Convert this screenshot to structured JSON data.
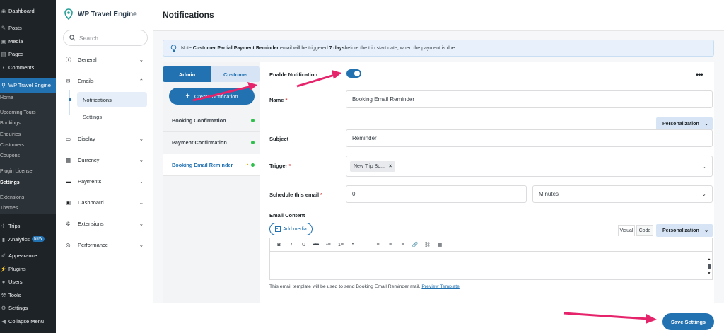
{
  "wp_sidebar": {
    "items": [
      {
        "label": "Dashboard",
        "icon": "dashboard-icon"
      },
      {
        "label": "Posts",
        "icon": "pin-icon"
      },
      {
        "label": "Media",
        "icon": "media-icon"
      },
      {
        "label": "Pages",
        "icon": "pages-icon"
      },
      {
        "label": "Comments",
        "icon": "comment-icon"
      },
      {
        "label": "WP Travel Engine",
        "icon": "travel-icon"
      }
    ],
    "submenu": [
      "Home",
      "Upcoming Tours",
      "Bookings",
      "Enquiries",
      "Customers",
      "Coupons",
      "Plugin License",
      "Settings",
      "Extensions",
      "Themes"
    ],
    "items2": [
      {
        "label": "Trips",
        "icon": "trips-icon"
      },
      {
        "label": "Analytics",
        "icon": "analytics-icon"
      },
      {
        "label": "Appearance",
        "icon": "brush-icon"
      },
      {
        "label": "Plugins",
        "icon": "plug-icon"
      },
      {
        "label": "Users",
        "icon": "user-icon"
      },
      {
        "label": "Tools",
        "icon": "wrench-icon"
      },
      {
        "label": "Settings",
        "icon": "settings-icon"
      },
      {
        "label": "Collapse Menu",
        "icon": "collapse-icon"
      }
    ],
    "new_badge": "NEW"
  },
  "plugin_nav": {
    "logo_text": "WP Travel Engine",
    "search_placeholder": "Search",
    "items": [
      "General",
      "Emails",
      "Display",
      "Currency",
      "Payments",
      "Dashboard",
      "Extensions",
      "Performance"
    ],
    "email_sub": [
      "Notifications",
      "Settings"
    ]
  },
  "header": {
    "title": "Notifications"
  },
  "note": {
    "prefix": "Note: ",
    "bold1": "Customer Partial Payment Reminder",
    "mid": " email will be triggered ",
    "bold2": "7 days",
    "suffix": " before the trip start date, when the payment is due."
  },
  "tabs": {
    "admin": "Admin",
    "customer": "Customer"
  },
  "create_button": "Create Notification",
  "notifications": [
    "Booking Confirmation",
    "Payment Confirmation",
    "Booking Email Reminder"
  ],
  "form": {
    "enable_label": "Enable Notification",
    "enabled": true,
    "name_label": "Name",
    "name_value": "Booking Email Reminder",
    "personalization": "Personalization",
    "subject_label": "Subject",
    "subject_value": "Reminder",
    "trigger_label": "Trigger",
    "trigger_tag": "New Trip Bo...",
    "schedule_label": "Schedule this email",
    "schedule_value": "0",
    "schedule_unit": "Minutes",
    "content_label": "Email Content",
    "add_media": "Add media",
    "visual_tab": "Visual",
    "code_tab": "Code",
    "toolbar": [
      "B",
      "I",
      "U",
      "abc",
      "•≡",
      "1≡",
      "❝",
      "—",
      "≡",
      "≡",
      "≡",
      "🔗",
      "⛓",
      "▦"
    ],
    "help_text": "This email template will be used to send Booking Email Reminder mail.",
    "preview_link": "Preview Template"
  },
  "footer": {
    "save": "Save Settings"
  },
  "colors": {
    "accent": "#2271b1",
    "arrow": "#e6246b",
    "wp_dark": "#1d2327"
  }
}
